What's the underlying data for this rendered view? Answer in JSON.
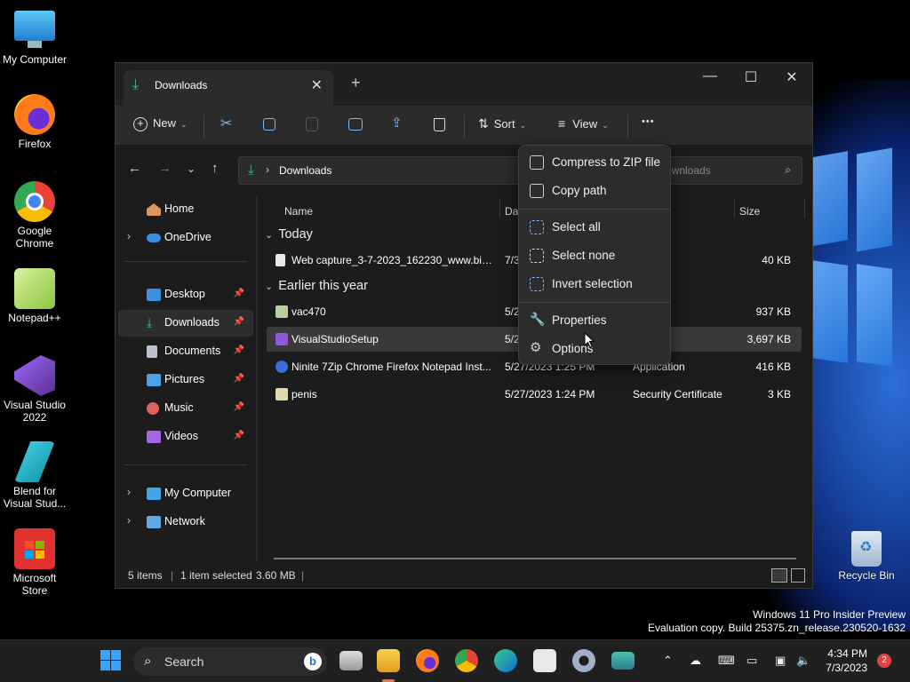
{
  "desktop": {
    "icons": [
      {
        "label": "My Computer",
        "icon": "monitor-icon"
      },
      {
        "label": "Firefox",
        "icon": "firefox-icon"
      },
      {
        "label": "Google Chrome",
        "icon": "chrome-icon"
      },
      {
        "label": "Notepad++",
        "icon": "notepadpp-icon"
      },
      {
        "label": "Visual Studio 2022",
        "icon": "visual-studio-icon"
      },
      {
        "label": "Blend for Visual Stud...",
        "icon": "blend-icon"
      },
      {
        "label": "Microsoft Store",
        "icon": "store-icon"
      }
    ],
    "recycle_bin": "Recycle Bin",
    "watermark_line1": "Windows 11 Pro Insider Preview",
    "watermark_line2": "Evaluation copy. Build 25375.zn_release.230520-1632"
  },
  "window": {
    "tab_title": "Downloads",
    "new_tab": "+",
    "controls": {
      "minimize": "—",
      "maximize": "☐",
      "close": "✕"
    }
  },
  "toolbar": {
    "new_label": "New",
    "sort_label": "Sort",
    "view_label": "View",
    "more_label": "•••"
  },
  "address": {
    "path": "Downloads",
    "search_placeholder": "ownloads"
  },
  "sidebar": {
    "home": "Home",
    "onedrive": "OneDrive",
    "quick": [
      {
        "label": "Desktop",
        "color": "#3d8fe0"
      },
      {
        "label": "Downloads",
        "color": "#3ec17a"
      },
      {
        "label": "Documents",
        "color": "#b9c1cc"
      },
      {
        "label": "Pictures",
        "color": "#4aa3e8"
      },
      {
        "label": "Music",
        "color": "#e06060"
      },
      {
        "label": "Videos",
        "color": "#a067e0"
      }
    ],
    "my_computer": "My Computer",
    "network": "Network"
  },
  "columns": {
    "name": "Name",
    "date": "Da",
    "size": "Size"
  },
  "groups": {
    "today": "Today",
    "earlier": "Earlier this year"
  },
  "files": [
    {
      "name": "Web capture_3-7-2023_162230_www.bin...",
      "date": "7/3",
      "type": "e",
      "size": "40 KB"
    },
    {
      "name": "vac470",
      "date": "5/2",
      "type": "ation",
      "size": "937 KB"
    },
    {
      "name": "VisualStudioSetup",
      "date": "5/2",
      "type": "ation",
      "size": "3,697 KB"
    },
    {
      "name": "Ninite 7Zip Chrome Firefox Notepad Inst...",
      "date": "5/27/2023 1:25 PM",
      "type": "Application",
      "size": "416 KB"
    },
    {
      "name": "penis",
      "date": "5/27/2023 1:24 PM",
      "type": "Security Certificate",
      "size": "3 KB"
    }
  ],
  "context_menu": [
    "Compress to ZIP file",
    "Copy path",
    "Select all",
    "Select none",
    "Invert selection",
    "Properties",
    "Options"
  ],
  "status": {
    "items": "5 items",
    "selected": "1 item selected",
    "size": "3.60 MB"
  },
  "taskbar": {
    "search": "Search",
    "time": "4:34 PM",
    "date": "7/3/2023",
    "badge": "2"
  }
}
